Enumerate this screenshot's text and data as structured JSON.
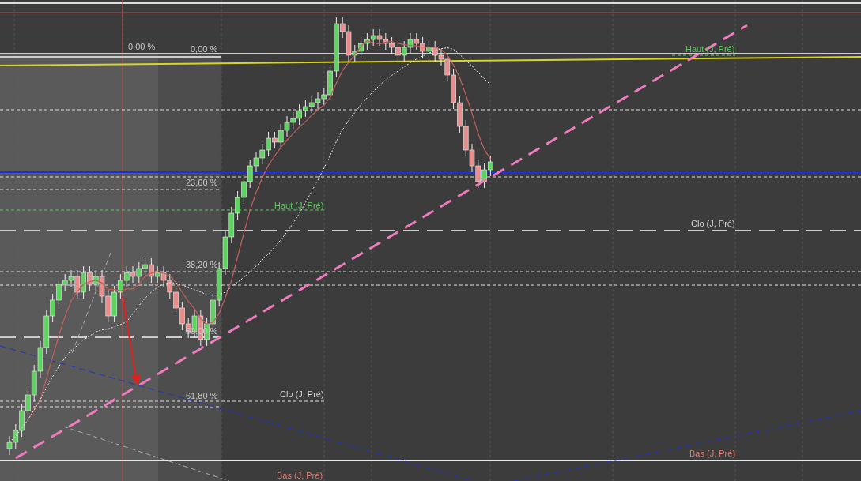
{
  "chart_labels": [
    {
      "text": "0,00 %",
      "kind": "level"
    },
    {
      "text": "0,00 %",
      "kind": "level"
    },
    {
      "text": "Haut (J, Pré)",
      "kind": "high"
    },
    {
      "text": "23,60 %",
      "kind": "level"
    },
    {
      "text": "Haut (J, Pré)",
      "kind": "high"
    },
    {
      "text": "Clo (J, Pré)",
      "kind": "close"
    },
    {
      "text": "38,20 %",
      "kind": "level"
    },
    {
      "text": "50,00 %",
      "kind": "level"
    },
    {
      "text": "61,80 %",
      "kind": "level"
    },
    {
      "text": "Clo (J, Pré)",
      "kind": "close"
    },
    {
      "text": "Bas (J, Pré)",
      "kind": "low"
    },
    {
      "text": "Bas (J, Pré)",
      "kind": "low"
    }
  ]
}
